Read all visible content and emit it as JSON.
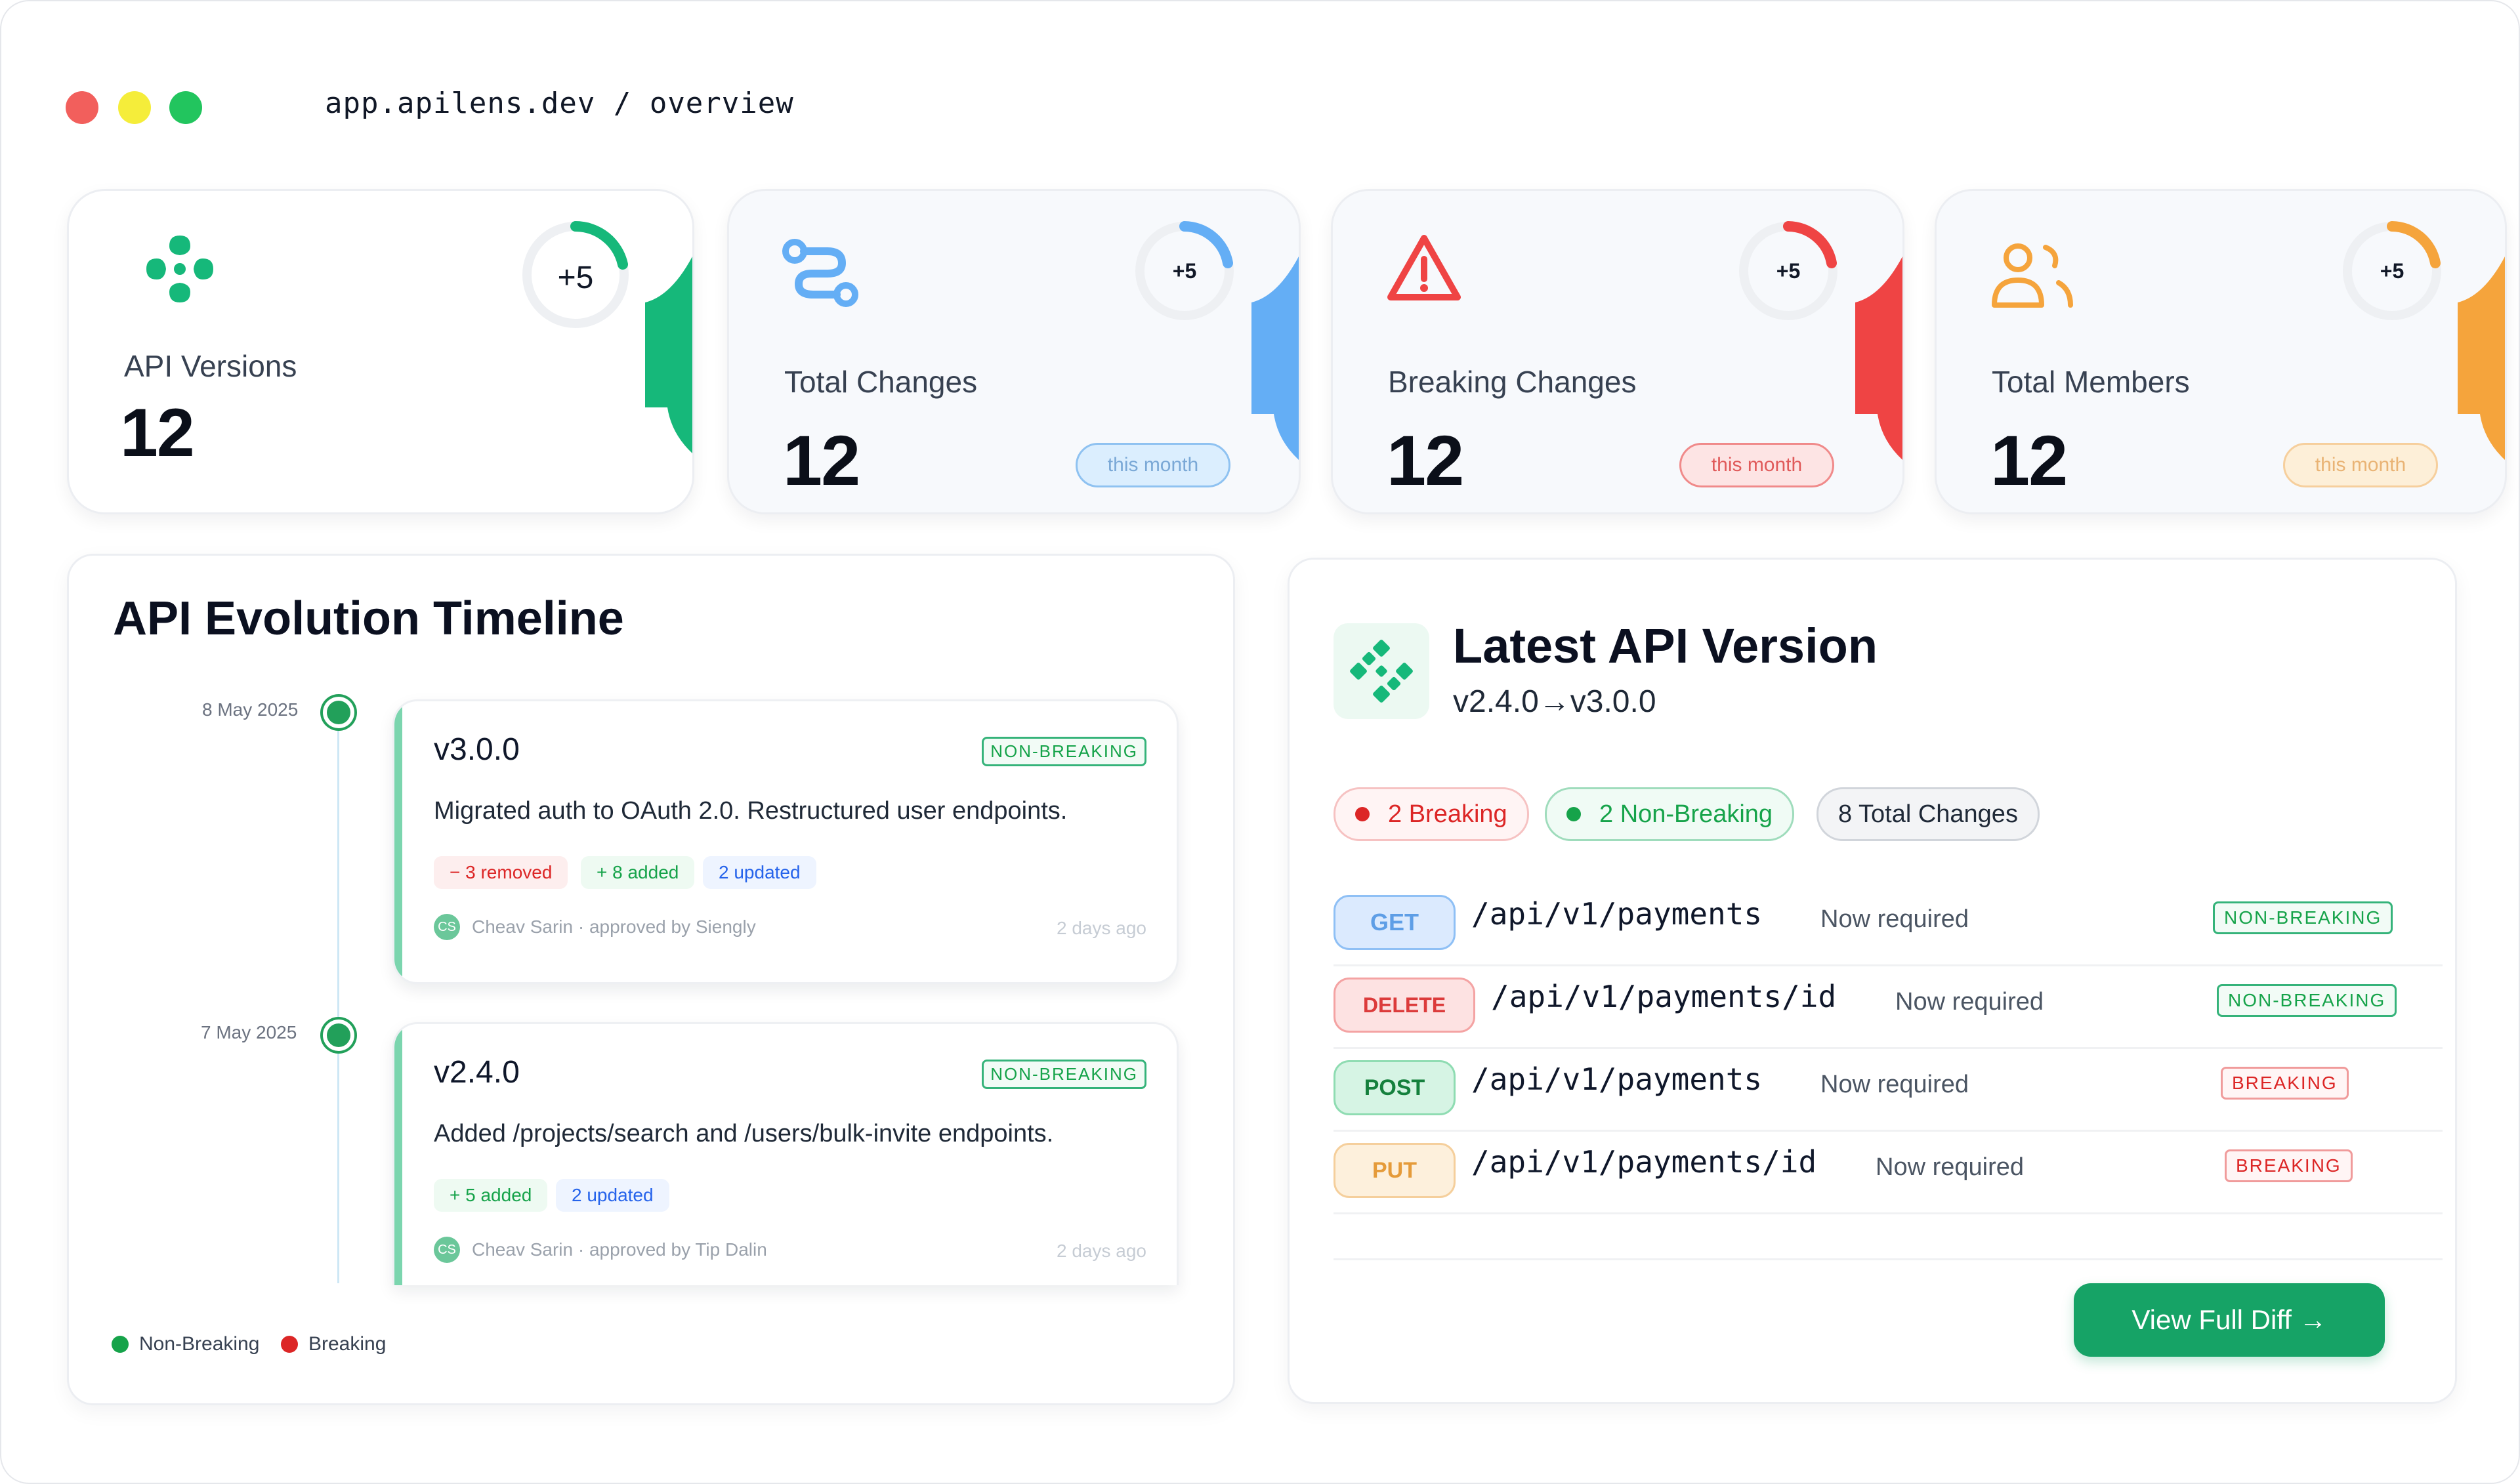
{
  "window": {
    "url": "app.apilens.dev / overview",
    "colors": {
      "close": "#f25f5c",
      "minimize": "#f5ed3a",
      "maximize": "#22c55e"
    }
  },
  "stats": [
    {
      "label": "API Versions",
      "value": "12",
      "delta": "+5",
      "color": "#16b87a",
      "icon": "four-dots-icon",
      "period": ""
    },
    {
      "label": "Total Changes",
      "value": "12",
      "delta": "+5",
      "color": "#64aef5",
      "icon": "route-icon",
      "period": "this month"
    },
    {
      "label": "Breaking Changes",
      "value": "12",
      "delta": "+5",
      "color": "#ef4444",
      "icon": "warning-triangle-icon",
      "period": "this month"
    },
    {
      "label": "Total Members",
      "value": "12",
      "delta": "+5",
      "color": "#f5a43c",
      "icon": "users-icon",
      "period": "this month"
    }
  ],
  "timeline": {
    "title": "API Evolution Timeline",
    "entries": [
      {
        "date": "8 May 2025",
        "version": "v3.0.0",
        "badge": "NON-BREAKING",
        "description": "Migrated auth to OAuth 2.0. Restructured user endpoints.",
        "chips": [
          "− 3 removed",
          "+ 8 added",
          "2 updated"
        ],
        "avatar": "CS",
        "author": "Cheav Sarin · approved by Sienglу",
        "ago": "2 days ago"
      },
      {
        "date": "7 May 2025",
        "version": "v2.4.0",
        "badge": "NON-BREAKING",
        "description": "Added /projects/search and /users/bulk-invite endpoints.",
        "chips": [
          "+ 5 added",
          "2 updated"
        ],
        "avatar": "CS",
        "author": "Cheav Sarin · approved by Tip Dalin",
        "ago": "2 days ago"
      }
    ],
    "legend": [
      "Non-Breaking",
      "Breaking"
    ]
  },
  "latest": {
    "title": "Latest API Version",
    "subtitle": "v2.4.0→v3.0.0",
    "summary": [
      "2 Breaking",
      "2 Non-Breaking",
      "8 Total Changes"
    ],
    "rows": [
      {
        "method": "GET",
        "path": "/api/v1/payments",
        "note": "Now required",
        "tag": "NON-BREAKING"
      },
      {
        "method": "DELETE",
        "path": "/api/v1/payments/id",
        "note": "Now required",
        "tag": "NON-BREAKING"
      },
      {
        "method": "POST",
        "path": "/api/v1/payments",
        "note": "Now required",
        "tag": "BREAKING"
      },
      {
        "method": "PUT",
        "path": "/api/v1/payments/id",
        "note": "Now required",
        "tag": "BREAKING"
      }
    ],
    "button": "View Full Diff →"
  }
}
